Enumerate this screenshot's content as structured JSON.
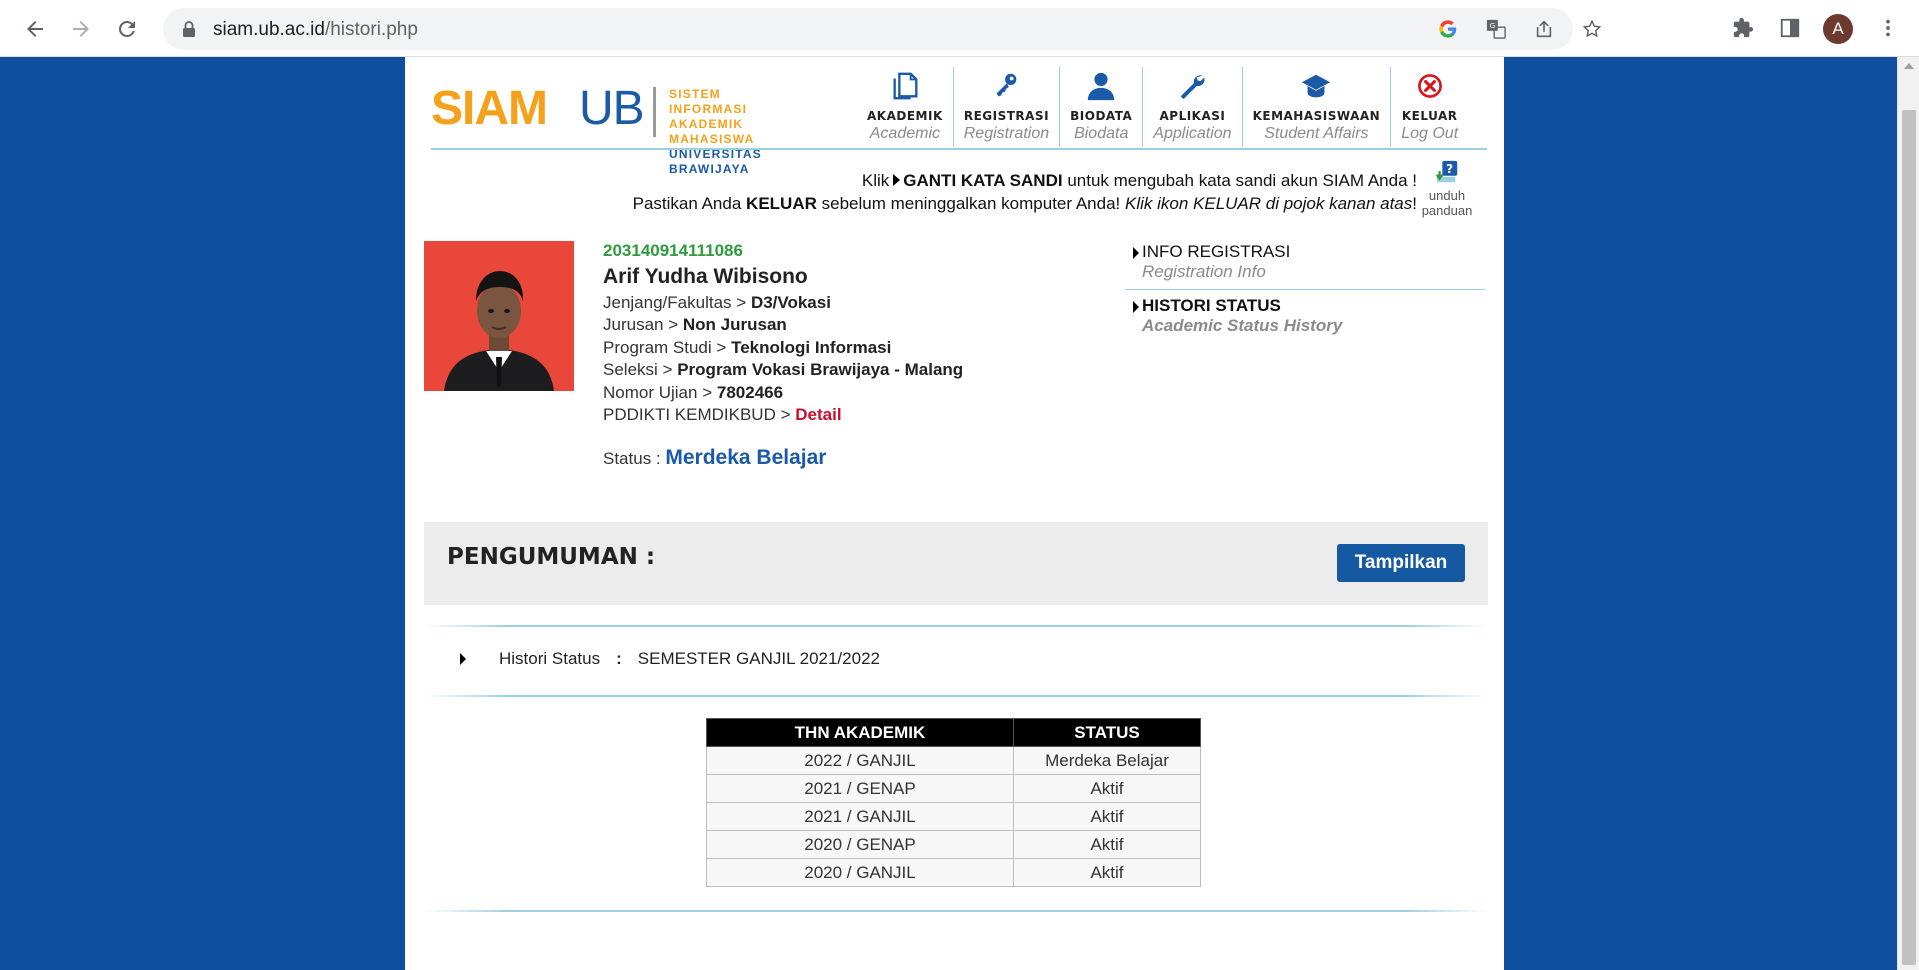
{
  "browser": {
    "url_host": "siam.ub.ac.id",
    "url_path": "/histori.php",
    "avatar_letter": "A"
  },
  "header": {
    "logo_siam": "SIAM",
    "logo_ub": "UB",
    "logo_line1": "SISTEM INFORMASI",
    "logo_line2": "AKADEMIK MAHASISWA",
    "logo_line3": "UNIVERSITAS BRAWIJAYA",
    "menu": [
      {
        "label": "AKADEMIK",
        "sub": "Academic",
        "icon": "document-icon"
      },
      {
        "label": "REGISTRASI",
        "sub": "Registration",
        "icon": "key-icon"
      },
      {
        "label": "BIODATA",
        "sub": "Biodata",
        "icon": "user-icon"
      },
      {
        "label": "APLIKASI",
        "sub": "Application",
        "icon": "wrench-icon"
      },
      {
        "label": "KEMAHASISWAAN",
        "sub": "Student Affairs",
        "icon": "graduation-cap-icon"
      },
      {
        "label": "KELUAR",
        "sub": "Log Out",
        "icon": "close-circle-icon"
      }
    ]
  },
  "notice": {
    "line1_pre": "Klik",
    "line1_bold": "GANTI KATA SANDI",
    "line1_post": "untuk mengubah kata sandi akun SIAM Anda !",
    "line2_pre": "Pastikan Anda",
    "line2_bold": "KELUAR",
    "line2_mid": "sebelum meninggalkan komputer Anda!",
    "line2_italic": "Klik ikon KELUAR di pojok kanan atas",
    "line2_end": "!",
    "unduh_line1": "unduh",
    "unduh_line2": "panduan"
  },
  "profile": {
    "nim": "203140914111086",
    "name": "Arif Yudha Wibisono",
    "rows": [
      {
        "label": "Jenjang/Fakultas",
        "value": "D3/Vokasi"
      },
      {
        "label": "Jurusan",
        "value": "Non Jurusan"
      },
      {
        "label": "Program Studi",
        "value": "Teknologi Informasi"
      },
      {
        "label": "Seleksi",
        "value": "Program Vokasi Brawijaya - Malang"
      },
      {
        "label": "Nomor Ujian",
        "value": "7802466"
      }
    ],
    "pddikti_label": "PDDIKTI KEMDIKBUD",
    "pddikti_link": "Detail",
    "status_label": "Status :",
    "status_value": "Merdeka Belajar",
    "separator": ">"
  },
  "side_links": [
    {
      "title": "INFO REGISTRASI",
      "sub": "Registration Info"
    },
    {
      "title": "HISTORI STATUS",
      "sub": "Academic Status History"
    }
  ],
  "pengumuman": {
    "title": "PENGUMUMAN :",
    "button": "Tampilkan"
  },
  "histori": {
    "label": "Histori Status",
    "colon": ":",
    "value": "SEMESTER GANJIL 2021/2022"
  },
  "table": {
    "headers": [
      "THN AKADEMIK",
      "STATUS"
    ],
    "rows": [
      [
        "2022 / GANJIL",
        "Merdeka Belajar"
      ],
      [
        "2021 / GENAP",
        "Aktif"
      ],
      [
        "2021 / GANJIL",
        "Aktif"
      ],
      [
        "2020 / GENAP",
        "Aktif"
      ],
      [
        "2020 / GANJIL",
        "Aktif"
      ]
    ]
  },
  "colors": {
    "background": "#0e4f9e",
    "brand_orange": "#f5a11b",
    "brand_blue": "#1b5aa6",
    "nim_green": "#2e9b3e",
    "detail_red": "#c8102e",
    "button_blue": "#1559a2"
  }
}
